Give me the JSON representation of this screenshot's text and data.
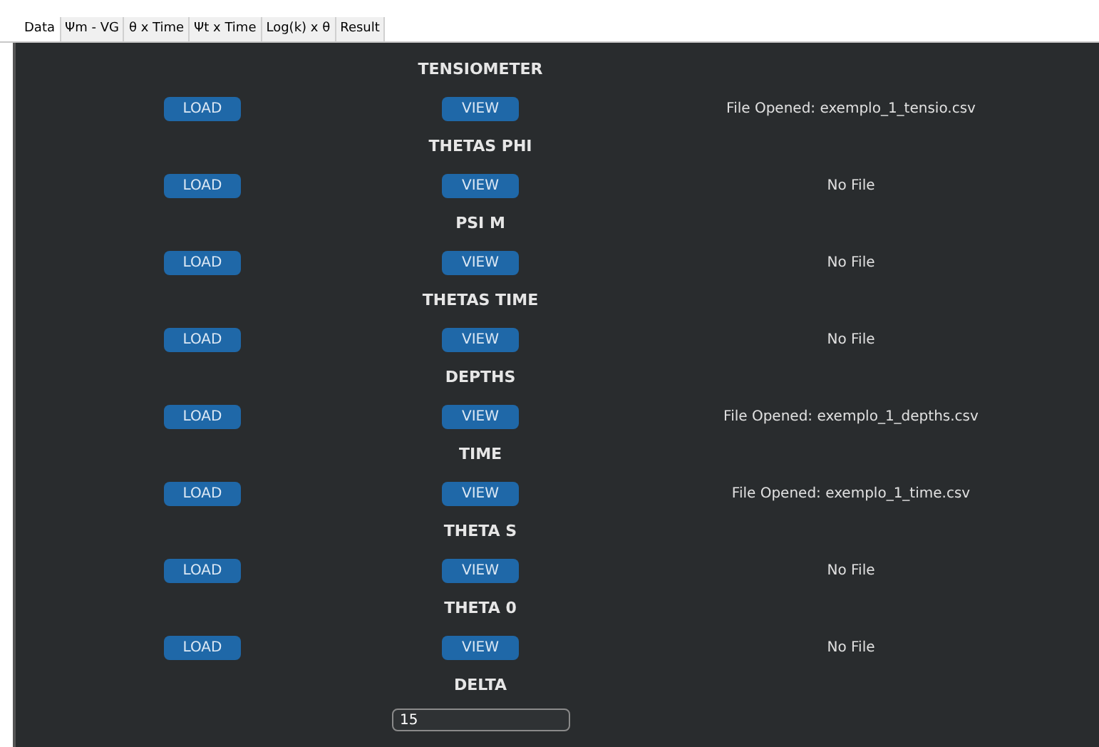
{
  "tabs": [
    {
      "label": "Data",
      "selected": true
    },
    {
      "label": "Ψm - VG",
      "selected": false
    },
    {
      "label": "θ x Time",
      "selected": false
    },
    {
      "label": "Ψt x Time",
      "selected": false
    },
    {
      "label": "Log(k) x θ",
      "selected": false
    },
    {
      "label": "Result",
      "selected": false
    }
  ],
  "sections": [
    {
      "heading": "TENSIOMETER",
      "load": "LOAD",
      "view": "VIEW",
      "status": "File Opened: exemplo_1_tensio.csv"
    },
    {
      "heading": "THETAS PHI",
      "load": "LOAD",
      "view": "VIEW",
      "status": "No File"
    },
    {
      "heading": "PSI M",
      "load": "LOAD",
      "view": "VIEW",
      "status": "No File"
    },
    {
      "heading": "THETAS TIME",
      "load": "LOAD",
      "view": "VIEW",
      "status": "No File"
    },
    {
      "heading": "DEPTHS",
      "load": "LOAD",
      "view": "VIEW",
      "status": "File Opened: exemplo_1_depths.csv"
    },
    {
      "heading": "TIME",
      "load": "LOAD",
      "view": "VIEW",
      "status": "File Opened: exemplo_1_time.csv"
    },
    {
      "heading": "THETA S",
      "load": "LOAD",
      "view": "VIEW",
      "status": "No File"
    },
    {
      "heading": "THETA 0",
      "load": "LOAD",
      "view": "VIEW",
      "status": "No File"
    }
  ],
  "delta": {
    "heading": "DELTA",
    "value": "15"
  }
}
